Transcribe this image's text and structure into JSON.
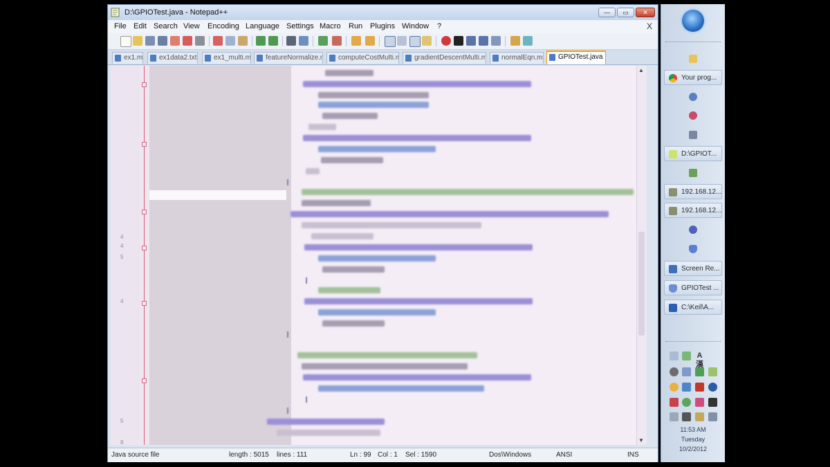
{
  "window": {
    "title": "D:\\GPIOTest.java - Notepad++",
    "buttons": {
      "minimize": "—",
      "maximize": "▭",
      "close": "✕"
    }
  },
  "menu": {
    "items": [
      "File",
      "Edit",
      "Search",
      "View",
      "Encoding",
      "Language",
      "Settings",
      "Macro",
      "Run",
      "Plugins",
      "Window",
      "?"
    ],
    "close": "X"
  },
  "tabs": [
    {
      "label": "ex1.m",
      "active": false
    },
    {
      "label": "ex1data2.txt",
      "active": false
    },
    {
      "label": "ex1_multi.m",
      "active": false
    },
    {
      "label": "featureNormalize.m",
      "active": false
    },
    {
      "label": "computeCostMulti.m",
      "active": false
    },
    {
      "label": "gradientDescentMulti.m",
      "active": false
    },
    {
      "label": "normalEqn.m",
      "active": false
    },
    {
      "label": "GPIOTest.java",
      "active": true
    }
  ],
  "editor": {
    "line_numbers": [
      "4",
      "4",
      "5",
      "4",
      "5",
      "8"
    ],
    "scroll_up": "▲",
    "scroll_down": "▼"
  },
  "status": {
    "file_type": "Java source file",
    "length": "length : 5015",
    "lines": "lines : 111",
    "ln": "Ln : 99",
    "col": "Col : 1",
    "sel": "Sel : 1590",
    "eol": "Dos\\Windows",
    "encoding": "ANSI",
    "mode": "INS"
  },
  "taskbar": {
    "items": [
      {
        "label": "",
        "icon": "folder-icon"
      },
      {
        "label": "Your prog...",
        "icon": "chrome-icon"
      },
      {
        "label": "",
        "icon": "app-icon"
      },
      {
        "label": "",
        "icon": "app-icon"
      },
      {
        "label": "",
        "icon": "floppy-icon"
      },
      {
        "label": "D:\\GPIOT...",
        "icon": "notepadpp-icon"
      },
      {
        "label": "",
        "icon": "app-icon"
      },
      {
        "label": "192.168.12...",
        "icon": "putty-icon"
      },
      {
        "label": "192.168.12...",
        "icon": "putty-icon"
      },
      {
        "label": "",
        "icon": "app-icon"
      },
      {
        "label": "",
        "icon": "shield-icon"
      },
      {
        "label": "Screen Re...",
        "icon": "screen-recorder-icon"
      },
      {
        "label": "GPIOTest ...",
        "icon": "java-icon"
      },
      {
        "label": "C:\\Keil\\A...",
        "icon": "keil-icon"
      }
    ],
    "tray_text": "A 漢",
    "clock": {
      "time": "11:53 AM",
      "day": "Tuesday",
      "date": "10/2/2012"
    }
  },
  "colors": {
    "accent": "#f0a000",
    "fold_line": "#e05b7a",
    "editor_bg": "#f4edf6"
  }
}
